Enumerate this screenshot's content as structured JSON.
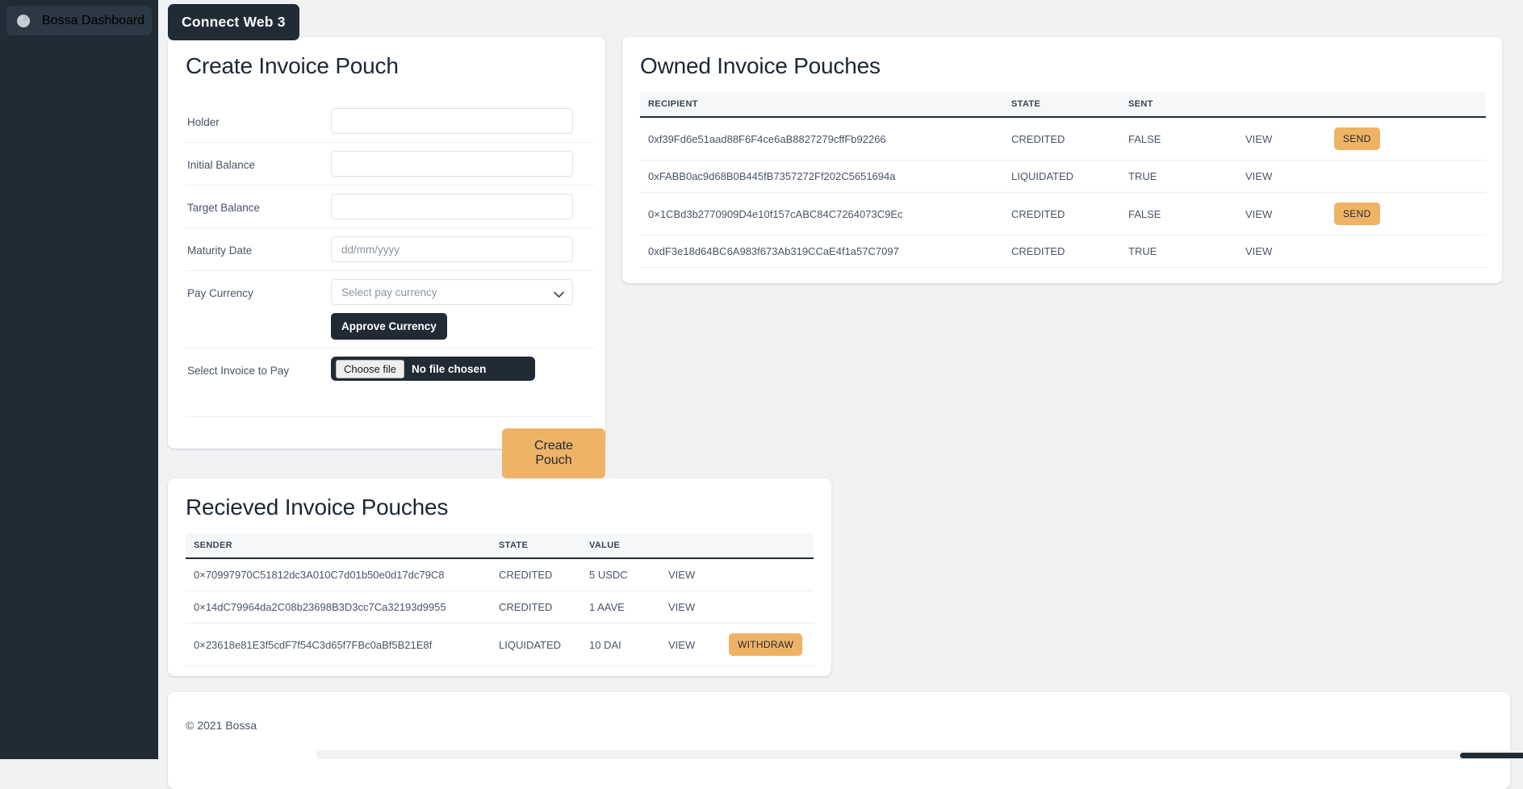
{
  "sidebar": {
    "brand_label": "Bossa Dashboard",
    "brand_icon": "pie-chart-icon"
  },
  "header": {
    "connect_label": "Connect Web 3"
  },
  "create_pouch": {
    "title": "Create Invoice Pouch",
    "fields": [
      {
        "label": "Holder",
        "value": "",
        "placeholder": ""
      },
      {
        "label": "Initial Balance",
        "value": "",
        "placeholder": ""
      },
      {
        "label": "Target Balance",
        "value": "",
        "placeholder": ""
      },
      {
        "label": "Maturity Date",
        "value": "",
        "placeholder": "dd/mm/yyyy"
      }
    ],
    "pay_currency": {
      "label": "Pay Currency",
      "selected": "Select pay currency",
      "approve_label": "Approve Currency"
    },
    "invoice_file": {
      "label": "Select Invoice to Pay",
      "choose_label": "Choose file",
      "status": "No file chosen"
    },
    "submit_label": "Create Pouch"
  },
  "owned_pouches": {
    "title": "Owned Invoice Pouches",
    "columns": [
      "RECIPIENT",
      "STATE",
      "SENT",
      "",
      ""
    ],
    "rows": [
      {
        "recipient": "0xf39Fd6e51aad88F6F4ce6aB8827279cffFb92266",
        "state": "CREDITED",
        "sent": "FALSE",
        "view": "VIEW",
        "action": "SEND"
      },
      {
        "recipient": "0xFABB0ac9d68B0B445fB7357272Ff202C5651694a",
        "state": "LIQUIDATED",
        "sent": "TRUE",
        "view": "VIEW",
        "action": ""
      },
      {
        "recipient": "0×1CBd3b2770909D4e10f157cABC84C7264073C9Ec",
        "state": "CREDITED",
        "sent": "FALSE",
        "view": "VIEW",
        "action": "SEND"
      },
      {
        "recipient": "0xdF3e18d64BC6A983f673Ab319CCaE4f1a57C7097",
        "state": "CREDITED",
        "sent": "TRUE",
        "view": "VIEW",
        "action": ""
      }
    ]
  },
  "received_pouches": {
    "title": "Recieved Invoice Pouches",
    "columns": [
      "SENDER",
      "STATE",
      "VALUE",
      "",
      ""
    ],
    "rows": [
      {
        "sender": "0×70997970C51812dc3A010C7d01b50e0d17dc79C8",
        "state": "CREDITED",
        "value": "5 USDC",
        "view": "VIEW",
        "action": ""
      },
      {
        "sender": "0×14dC79964da2C08b23698B3D3cc7Ca32193d9955",
        "state": "CREDITED",
        "value": "1 AAVE",
        "view": "VIEW",
        "action": ""
      },
      {
        "sender": "0×23618e81E3f5cdF7f54C3d65f7FBc0aBf5B21E8f",
        "state": "LIQUIDATED",
        "value": "10 DAI",
        "view": "VIEW",
        "action": "WITHDRAW"
      }
    ]
  },
  "footer": {
    "copyright": "© 2021 Bossa"
  },
  "colors": {
    "accent": "#efb366",
    "dark": "#212b36",
    "page_bg": "#f1f2f4",
    "card_bg": "#ffffff",
    "text": "#4a5464"
  }
}
